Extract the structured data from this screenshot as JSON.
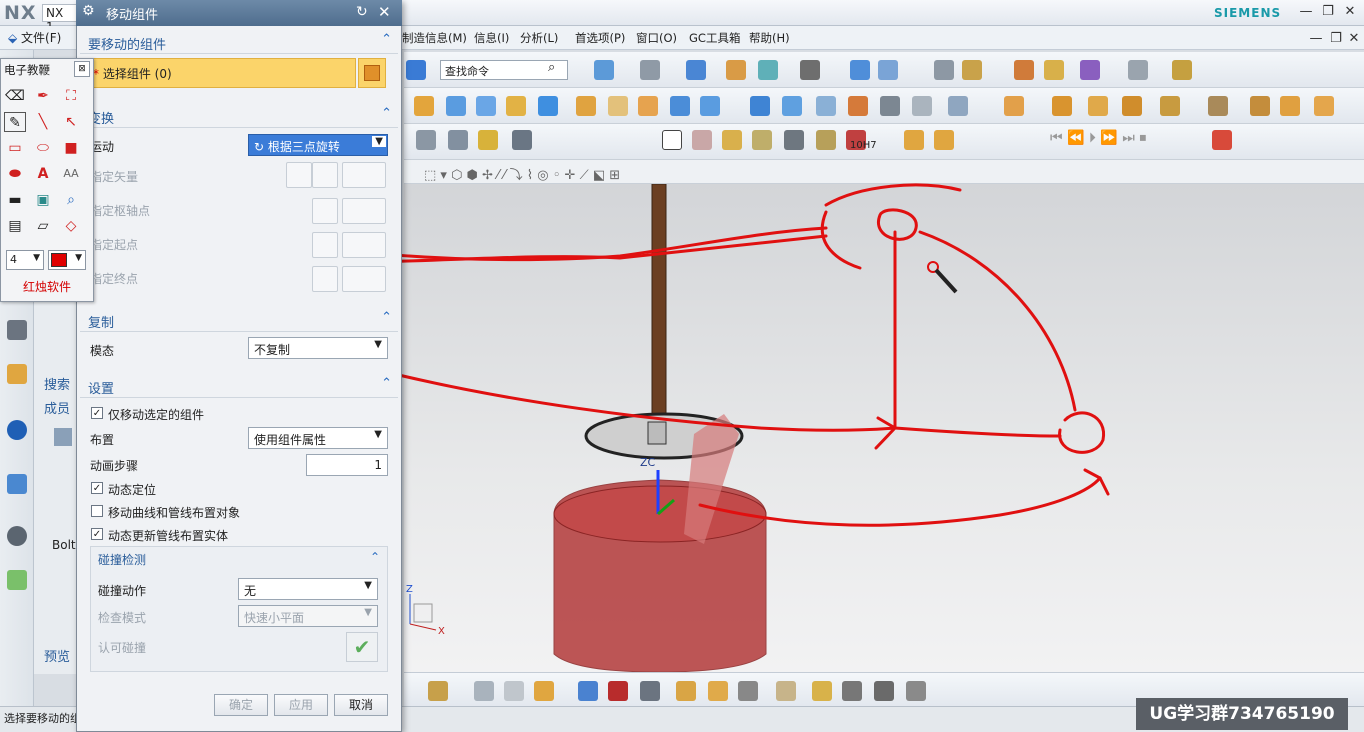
{
  "app": {
    "logo": "NX",
    "version": "NX 1",
    "brand": "SIEMENS"
  },
  "menu": {
    "file": "文件(F)",
    "items": [
      "制造信息(M)",
      "信息(I)",
      "分析(L)",
      "首选项(P)",
      "窗口(O)",
      "GC工具箱",
      "帮助(H)"
    ]
  },
  "toolbar": {
    "find_placeholder": "查找命令",
    "dimension_label": "10H7"
  },
  "dialog": {
    "title": "移动组件",
    "sections": {
      "select": {
        "header": "要移动的组件",
        "select_label": "选择组件 (0)"
      },
      "transform": {
        "header": "变换",
        "motion_label": "运动",
        "motion_value": "根据三点旋转",
        "vector_label": "指定矢量",
        "pivot_label": "指定枢轴点",
        "start_label": "指定起点",
        "end_label": "指定终点"
      },
      "copy": {
        "header": "复制",
        "mode_label": "模态",
        "mode_value": "不复制"
      },
      "settings": {
        "header": "设置",
        "only_selected": "仅移动选定的组件",
        "layout_label": "布置",
        "layout_value": "使用组件属性",
        "anim_label": "动画步骤",
        "anim_value": "1",
        "dyn_pos": "动态定位",
        "move_curves": "移动曲线和管线布置对象",
        "dyn_update": "动态更新管线布置实体"
      },
      "collision": {
        "header": "碰撞检测",
        "action_label": "碰撞动作",
        "action_value": "无",
        "check_label": "检查模式",
        "check_value": "快速小平面",
        "allow_label": "认可碰撞"
      }
    },
    "buttons": {
      "ok": "确定",
      "apply": "应用",
      "cancel": "取消"
    },
    "checked": {
      "only_selected": true,
      "dyn_pos": true,
      "move_curves": false,
      "dyn_update": true
    }
  },
  "ebook": {
    "title": "电子教鞭",
    "close": "⊠",
    "size_value": "4",
    "brand": "红烛软件",
    "pen_color": "#e00000"
  },
  "navigator": {
    "search": "搜索",
    "members": "成员",
    "bolt": "Bolt",
    "preview": "预览"
  },
  "viewport": {
    "zc_label": "ZC",
    "triad_z": "Z",
    "triad_x": "X",
    "annotation_color": "#e01010"
  },
  "status": {
    "text": "选择要移动的组"
  },
  "watermark": {
    "text": "UG学习群734765190"
  }
}
